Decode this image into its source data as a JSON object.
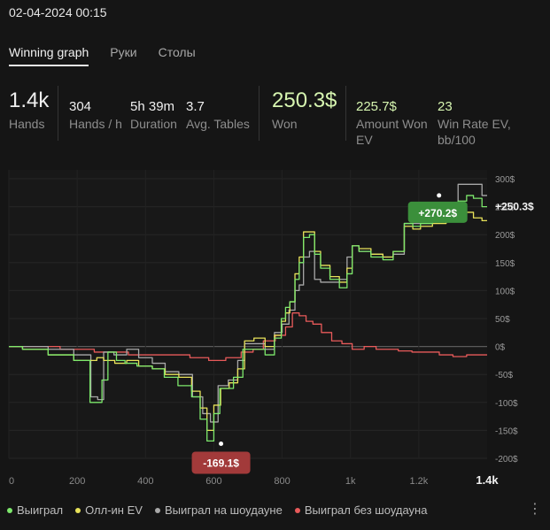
{
  "datetime": "02-04-2024 00:15",
  "tabs": [
    {
      "label": "Winning graph",
      "active": true
    },
    {
      "label": "Руки",
      "active": false
    },
    {
      "label": "Столы",
      "active": false
    }
  ],
  "stats": {
    "hands": {
      "value": "1.4k",
      "label": "Hands"
    },
    "hands_per_h": {
      "value": "304",
      "label": "Hands / h"
    },
    "duration": {
      "value": "5h 39m",
      "label": "Duration"
    },
    "avg_tables": {
      "value": "3.7",
      "label": "Avg. Tables"
    },
    "won": {
      "value": "250.3$",
      "label": "Won"
    },
    "amount_won_ev": {
      "value": "225.7$",
      "label_line1": "Amount Won",
      "label_line2": "EV"
    },
    "win_rate_ev": {
      "value": "23",
      "label_line1": "Win Rate EV,",
      "label_line2": "bb/100"
    }
  },
  "colors": {
    "won": "#7de86c",
    "allin_ev": "#e8e25a",
    "showdown": "#a8a8a8",
    "non_showdown": "#e85a5a",
    "accent_green_badge": "#3b8f3b",
    "accent_red_badge": "#a23a3a"
  },
  "chart_data": {
    "type": "line",
    "xlim": [
      0,
      1400
    ],
    "ylim": [
      -200,
      300
    ],
    "x_ticks": [
      {
        "value": 0,
        "label": "0"
      },
      {
        "value": 200,
        "label": "200"
      },
      {
        "value": 400,
        "label": "400"
      },
      {
        "value": 600,
        "label": "600"
      },
      {
        "value": 800,
        "label": "800"
      },
      {
        "value": 1000,
        "label": "1k"
      },
      {
        "value": 1200,
        "label": "1.2k"
      }
    ],
    "x_end_label": "1.4k",
    "y_ticks": [
      {
        "value": 300,
        "label": "300$"
      },
      {
        "value": 250,
        "label": "250$"
      },
      {
        "value": 200,
        "label": "200$"
      },
      {
        "value": 150,
        "label": "150$"
      },
      {
        "value": 100,
        "label": "100$"
      },
      {
        "value": 50,
        "label": "50$"
      },
      {
        "value": 0,
        "label": "0$"
      },
      {
        "value": -50,
        "label": "-50$"
      },
      {
        "value": -100,
        "label": "-100$"
      },
      {
        "value": -150,
        "label": "-150$"
      },
      {
        "value": -200,
        "label": "-200$"
      }
    ],
    "end_value_label": "+250.3$",
    "max_point": {
      "x": 1350,
      "y": 270.2,
      "label": "+270.2$"
    },
    "min_point": {
      "x": 590,
      "y": -169.1,
      "label": "-169.1$"
    },
    "series": [
      {
        "name": "Выиграл",
        "color": "#7de86c",
        "points": [
          [
            0,
            0
          ],
          [
            80,
            -5
          ],
          [
            150,
            -15
          ],
          [
            230,
            -25
          ],
          [
            245,
            -100
          ],
          [
            265,
            -100
          ],
          [
            280,
            -60
          ],
          [
            300,
            -10
          ],
          [
            330,
            -25
          ],
          [
            350,
            -30
          ],
          [
            400,
            -35
          ],
          [
            440,
            -40
          ],
          [
            470,
            -55
          ],
          [
            520,
            -70
          ],
          [
            550,
            -90
          ],
          [
            570,
            -130
          ],
          [
            590,
            -169
          ],
          [
            610,
            -120
          ],
          [
            625,
            -75
          ],
          [
            645,
            -75
          ],
          [
            670,
            -55
          ],
          [
            700,
            -5
          ],
          [
            735,
            -5
          ],
          [
            765,
            -15
          ],
          [
            790,
            15
          ],
          [
            805,
            50
          ],
          [
            815,
            70
          ],
          [
            830,
            80
          ],
          [
            845,
            120
          ],
          [
            855,
            150
          ],
          [
            870,
            195
          ],
          [
            890,
            200
          ],
          [
            900,
            165
          ],
          [
            925,
            140
          ],
          [
            955,
            120
          ],
          [
            980,
            105
          ],
          [
            1000,
            130
          ],
          [
            1010,
            180
          ],
          [
            1040,
            170
          ],
          [
            1080,
            160
          ],
          [
            1110,
            155
          ],
          [
            1140,
            170
          ],
          [
            1175,
            220
          ],
          [
            1190,
            215
          ],
          [
            1220,
            220
          ],
          [
            1260,
            230
          ],
          [
            1300,
            235
          ],
          [
            1330,
            260
          ],
          [
            1350,
            270
          ],
          [
            1370,
            265
          ],
          [
            1400,
            250
          ]
        ]
      },
      {
        "name": "Олл-ин EV",
        "color": "#e8e25a",
        "points": [
          [
            0,
            0
          ],
          [
            80,
            -5
          ],
          [
            150,
            -15
          ],
          [
            230,
            -25
          ],
          [
            250,
            -25
          ],
          [
            265,
            -20
          ],
          [
            290,
            -25
          ],
          [
            330,
            -30
          ],
          [
            360,
            -25
          ],
          [
            400,
            -35
          ],
          [
            440,
            -40
          ],
          [
            475,
            -50
          ],
          [
            520,
            -55
          ],
          [
            550,
            -80
          ],
          [
            570,
            -110
          ],
          [
            590,
            -150
          ],
          [
            610,
            -105
          ],
          [
            630,
            -75
          ],
          [
            660,
            -65
          ],
          [
            680,
            -40
          ],
          [
            700,
            10
          ],
          [
            735,
            15
          ],
          [
            765,
            0
          ],
          [
            790,
            20
          ],
          [
            805,
            45
          ],
          [
            815,
            60
          ],
          [
            830,
            80
          ],
          [
            845,
            130
          ],
          [
            855,
            160
          ],
          [
            870,
            205
          ],
          [
            890,
            205
          ],
          [
            900,
            170
          ],
          [
            925,
            145
          ],
          [
            955,
            125
          ],
          [
            980,
            115
          ],
          [
            1000,
            140
          ],
          [
            1010,
            180
          ],
          [
            1040,
            175
          ],
          [
            1080,
            165
          ],
          [
            1110,
            160
          ],
          [
            1140,
            170
          ],
          [
            1175,
            215
          ],
          [
            1190,
            210
          ],
          [
            1220,
            215
          ],
          [
            1260,
            220
          ],
          [
            1300,
            225
          ],
          [
            1330,
            235
          ],
          [
            1350,
            240
          ],
          [
            1370,
            230
          ],
          [
            1400,
            225
          ]
        ]
      },
      {
        "name": "Выиграл на шоудауне",
        "color": "#a8a8a8",
        "points": [
          [
            0,
            0
          ],
          [
            80,
            0
          ],
          [
            150,
            -5
          ],
          [
            230,
            -15
          ],
          [
            250,
            -90
          ],
          [
            270,
            -95
          ],
          [
            285,
            -10
          ],
          [
            330,
            -15
          ],
          [
            360,
            -5
          ],
          [
            400,
            -20
          ],
          [
            440,
            -30
          ],
          [
            475,
            -45
          ],
          [
            520,
            -50
          ],
          [
            555,
            -90
          ],
          [
            580,
            -120
          ],
          [
            600,
            -135
          ],
          [
            625,
            -70
          ],
          [
            660,
            -60
          ],
          [
            680,
            -25
          ],
          [
            700,
            5
          ],
          [
            735,
            5
          ],
          [
            765,
            -5
          ],
          [
            790,
            25
          ],
          [
            810,
            40
          ],
          [
            830,
            65
          ],
          [
            845,
            100
          ],
          [
            855,
            110
          ],
          [
            870,
            160
          ],
          [
            890,
            170
          ],
          [
            900,
            120
          ],
          [
            925,
            115
          ],
          [
            955,
            115
          ],
          [
            980,
            120
          ],
          [
            1000,
            160
          ],
          [
            1010,
            180
          ],
          [
            1040,
            170
          ],
          [
            1080,
            165
          ],
          [
            1110,
            160
          ],
          [
            1140,
            165
          ],
          [
            1175,
            220
          ],
          [
            1190,
            220
          ],
          [
            1220,
            220
          ],
          [
            1260,
            225
          ],
          [
            1300,
            240
          ],
          [
            1330,
            290
          ],
          [
            1350,
            290
          ],
          [
            1370,
            290
          ],
          [
            1400,
            270
          ]
        ]
      },
      {
        "name": "Выиграл без шоудауна",
        "color": "#e85a5a",
        "points": [
          [
            0,
            0
          ],
          [
            100,
            0
          ],
          [
            200,
            -5
          ],
          [
            300,
            -10
          ],
          [
            400,
            -15
          ],
          [
            500,
            -15
          ],
          [
            560,
            -20
          ],
          [
            610,
            -25
          ],
          [
            660,
            -20
          ],
          [
            700,
            -10
          ],
          [
            730,
            -5
          ],
          [
            760,
            10
          ],
          [
            800,
            20
          ],
          [
            820,
            35
          ],
          [
            840,
            60
          ],
          [
            860,
            55
          ],
          [
            880,
            45
          ],
          [
            900,
            40
          ],
          [
            930,
            25
          ],
          [
            960,
            10
          ],
          [
            990,
            5
          ],
          [
            1020,
            -5
          ],
          [
            1060,
            0
          ],
          [
            1090,
            -5
          ],
          [
            1120,
            -5
          ],
          [
            1160,
            -8
          ],
          [
            1200,
            -10
          ],
          [
            1240,
            -10
          ],
          [
            1280,
            -15
          ],
          [
            1320,
            -18
          ],
          [
            1360,
            -15
          ],
          [
            1400,
            -15
          ]
        ]
      }
    ]
  },
  "legend": [
    {
      "label": "Выиграл",
      "color": "#7de86c"
    },
    {
      "label": "Олл-ин EV",
      "color": "#e8e25a"
    },
    {
      "label": "Выиграл на шоудауне",
      "color": "#a8a8a8"
    },
    {
      "label": "Выиграл без шоудауна",
      "color": "#e85a5a"
    }
  ]
}
